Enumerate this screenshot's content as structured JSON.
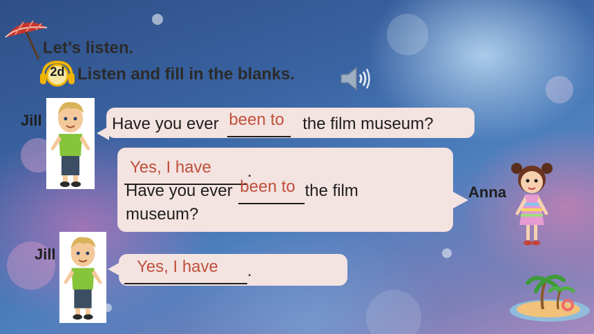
{
  "header": {
    "lets_listen": "Let’s listen.",
    "badge": "2d",
    "instruction": "Listen and fill in the blanks."
  },
  "dialogue": {
    "line1": {
      "speaker": "Jill",
      "text_before": "Have you ever",
      "answer": "been to",
      "text_after": "the film museum?"
    },
    "line2": {
      "speaker": "Anna",
      "answer1": "Yes, I have",
      "period1": ".",
      "text_before": "Have you ever",
      "answer2": "been to",
      "text_after_1": "the film",
      "text_after_2": "museum?"
    },
    "line3": {
      "speaker": "Jill",
      "answer": "Yes, I have",
      "period": "."
    }
  },
  "icons": [
    "umbrella-icon",
    "headphones-icon",
    "speaker-icon",
    "island-icon"
  ],
  "colors": {
    "answer": "#c0503a",
    "bubble": "#f3e3e1",
    "badge_ring": "#f0b400"
  }
}
